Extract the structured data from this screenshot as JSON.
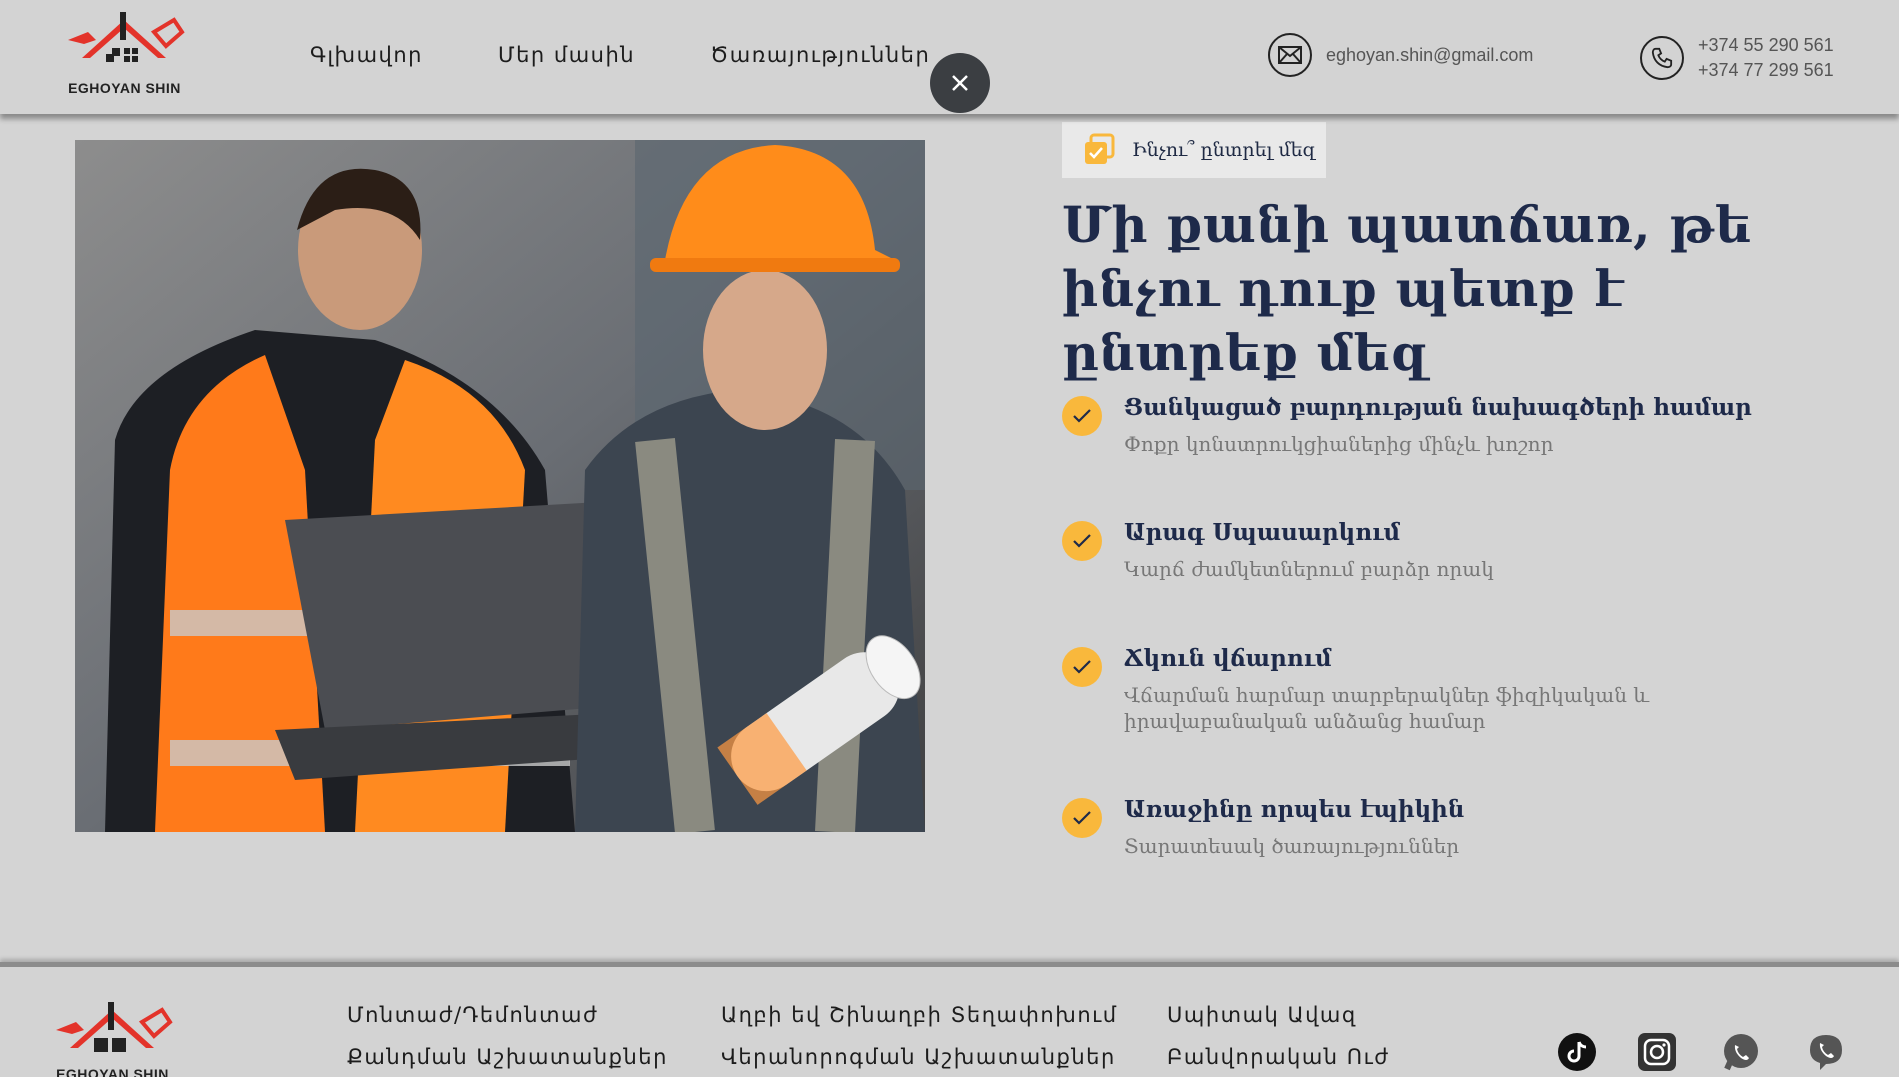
{
  "header": {
    "logo_text": "EGHOYAN SHIN",
    "nav": [
      "Գլխավոր",
      "Մեր մասին",
      "Ծառայություններ"
    ],
    "email": "eghoyan.shin@gmail.com",
    "phone1": "+374 55 290 561",
    "phone2": "+374 77 299 561"
  },
  "main": {
    "badge": "Ինչու՞ ընտրել մեզ",
    "headline": "Մի քանի պատճառ, թե ինչու դուք պետք է ընտրեք մեզ",
    "features": [
      {
        "title": "Ցանկացած բարդության նախագծերի համար",
        "desc": "Փոքր կոնստրուկցիաներից մինչև խոշոր"
      },
      {
        "title": "Արագ Սպասարկում",
        "desc": "Կարճ ժամկետներում բարձր որակ"
      },
      {
        "title": "Ճկուն վճարում",
        "desc": "Վճարման հարմար տարբերակներ ֆիզիկական և իրավաբանական անձանց համար"
      },
      {
        "title": "Առաջինը որպես էպիկին",
        "desc": "Տարատեսակ ծառայություններ"
      }
    ]
  },
  "footer": {
    "col1": [
      "Մոնտաժ/Դեմոնտաժ",
      "Քանդման Աշխատանքներ"
    ],
    "col2": [
      "Աղբի եվ Շինաղբի Տեղափոխում",
      "Վերանորոգման Աշխատանքներ"
    ],
    "col3": [
      "Սպիտակ Ավազ",
      "Բանվորական Ուժ"
    ],
    "social_icons": [
      "tiktok-icon",
      "instagram-icon",
      "whatsapp-icon",
      "viber-icon"
    ]
  },
  "colors": {
    "accent": "#f9b83c",
    "navy": "#1e2a4a",
    "brand_red": "#e3332a",
    "background": "#d4d4d4"
  }
}
